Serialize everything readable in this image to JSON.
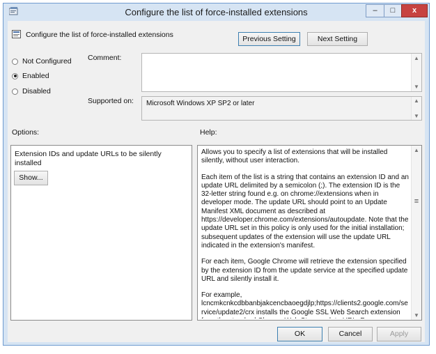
{
  "window": {
    "title": "Configure the list of force-installed extensions",
    "min_glyph": "–",
    "max_glyph": "□",
    "close_glyph": "x"
  },
  "header": {
    "policy_name": "Configure the list of force-installed extensions",
    "previous_label": "Previous Setting",
    "next_label": "Next Setting"
  },
  "state": {
    "options": [
      "Not Configured",
      "Enabled",
      "Disabled"
    ],
    "selected": "Enabled"
  },
  "comment": {
    "label": "Comment:",
    "value": ""
  },
  "supported": {
    "label": "Supported on:",
    "value": "Microsoft Windows XP SP2 or later"
  },
  "options_panel": {
    "label": "Options:",
    "description": "Extension IDs and update URLs to be silently installed",
    "show_label": "Show..."
  },
  "help_panel": {
    "label": "Help:",
    "paragraphs": [
      "Allows you to specify a list of extensions that will be installed silently, without user interaction.",
      "Each item of the list is a string that contains an extension ID and an update URL delimited by a semicolon (;). The extension ID is the 32-letter string found e.g. on chrome://extensions when in developer mode. The update URL should point to an Update Manifest XML document as described at https://developer.chrome.com/extensions/autoupdate. Note that the update URL set in this policy is only used for the initial installation; subsequent updates of the extension will use the update URL indicated in the extension's manifest.",
      "For each item, Google Chrome will retrieve the extension specified by the extension ID from the update service at the specified update URL and silently install it.",
      "For example, lcncmkcnkcdbbanbjakcencbaoegdjlp;https://clients2.google.com/service/update2/crx installs the Google SSL Web Search extension from the standard Chrome Web Store update URL. For"
    ]
  },
  "footer": {
    "ok_label": "OK",
    "cancel_label": "Cancel",
    "apply_label": "Apply"
  },
  "icons": {
    "app": "policy-editor-icon",
    "setting": "policy-setting-icon",
    "scroll_up": "▲",
    "scroll_down": "▼",
    "scroll_grip": "≡"
  },
  "colors": {
    "window_frame": "#d6e4f3",
    "close_button": "#c74341",
    "dialog_bg": "#f0f0f0"
  }
}
